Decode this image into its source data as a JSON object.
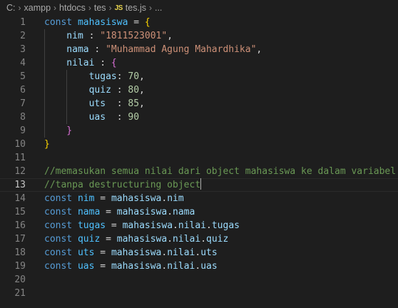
{
  "breadcrumb": {
    "items": [
      "C:",
      "xampp",
      "htdocs",
      "tes"
    ],
    "file_icon": "JS",
    "file_name": "tes.js",
    "ellipsis": "..."
  },
  "editor": {
    "current_line": 13,
    "lines": [
      {
        "n": 1,
        "indent": 0,
        "tokens": [
          [
            "const ",
            "t-keyword"
          ],
          [
            "mahasiswa",
            "t-const"
          ],
          [
            " = ",
            "t-punct"
          ],
          [
            "{",
            "t-brace1"
          ]
        ]
      },
      {
        "n": 2,
        "indent": 1,
        "tokens": [
          [
            "nim",
            "t-var"
          ],
          [
            " : ",
            "t-punct"
          ],
          [
            "\"1811523001\"",
            "t-string"
          ],
          [
            ",",
            "t-punct"
          ]
        ]
      },
      {
        "n": 3,
        "indent": 1,
        "tokens": [
          [
            "nama",
            "t-var"
          ],
          [
            " : ",
            "t-punct"
          ],
          [
            "\"Muhammad Agung Mahardhika\"",
            "t-string"
          ],
          [
            ",",
            "t-punct"
          ]
        ]
      },
      {
        "n": 4,
        "indent": 1,
        "tokens": [
          [
            "nilai",
            "t-var"
          ],
          [
            " : ",
            "t-punct"
          ],
          [
            "{",
            "t-brace2"
          ]
        ]
      },
      {
        "n": 5,
        "indent": 2,
        "tokens": [
          [
            "tugas",
            "t-var"
          ],
          [
            ": ",
            "t-punct"
          ],
          [
            "70",
            "t-number"
          ],
          [
            ",",
            "t-punct"
          ]
        ]
      },
      {
        "n": 6,
        "indent": 2,
        "tokens": [
          [
            "quiz",
            "t-var"
          ],
          [
            " : ",
            "t-punct"
          ],
          [
            "80",
            "t-number"
          ],
          [
            ",",
            "t-punct"
          ]
        ]
      },
      {
        "n": 7,
        "indent": 2,
        "tokens": [
          [
            "uts",
            "t-var"
          ],
          [
            "  : ",
            "t-punct"
          ],
          [
            "85",
            "t-number"
          ],
          [
            ",",
            "t-punct"
          ]
        ]
      },
      {
        "n": 8,
        "indent": 2,
        "tokens": [
          [
            "uas",
            "t-var"
          ],
          [
            "  : ",
            "t-punct"
          ],
          [
            "90",
            "t-number"
          ]
        ]
      },
      {
        "n": 9,
        "indent": 1,
        "tokens": [
          [
            "}",
            "t-brace2"
          ]
        ]
      },
      {
        "n": 10,
        "indent": 0,
        "tokens": [
          [
            "}",
            "t-brace1"
          ]
        ]
      },
      {
        "n": 11,
        "indent": 0,
        "tokens": []
      },
      {
        "n": 12,
        "indent": 0,
        "tokens": [
          [
            "//memasukan semua nilai dari object mahasiswa ke dalam variabel",
            "t-comment"
          ]
        ]
      },
      {
        "n": 13,
        "indent": 0,
        "cursor": true,
        "tokens": [
          [
            "//tanpa destructuring object",
            "t-comment"
          ]
        ]
      },
      {
        "n": 14,
        "indent": 0,
        "tokens": [
          [
            "const ",
            "t-keyword"
          ],
          [
            "nim",
            "t-const"
          ],
          [
            " = ",
            "t-punct"
          ],
          [
            "mahasiswa",
            "t-var"
          ],
          [
            ".",
            "t-punct"
          ],
          [
            "nim",
            "t-var"
          ]
        ]
      },
      {
        "n": 15,
        "indent": 0,
        "tokens": [
          [
            "const ",
            "t-keyword"
          ],
          [
            "nama",
            "t-const"
          ],
          [
            " = ",
            "t-punct"
          ],
          [
            "mahasiswa",
            "t-var"
          ],
          [
            ".",
            "t-punct"
          ],
          [
            "nama",
            "t-var"
          ]
        ]
      },
      {
        "n": 16,
        "indent": 0,
        "tokens": [
          [
            "const ",
            "t-keyword"
          ],
          [
            "tugas",
            "t-const"
          ],
          [
            " = ",
            "t-punct"
          ],
          [
            "mahasiswa",
            "t-var"
          ],
          [
            ".",
            "t-punct"
          ],
          [
            "nilai",
            "t-var"
          ],
          [
            ".",
            "t-punct"
          ],
          [
            "tugas",
            "t-var"
          ]
        ]
      },
      {
        "n": 17,
        "indent": 0,
        "tokens": [
          [
            "const ",
            "t-keyword"
          ],
          [
            "quiz",
            "t-const"
          ],
          [
            " = ",
            "t-punct"
          ],
          [
            "mahasiswa",
            "t-var"
          ],
          [
            ".",
            "t-punct"
          ],
          [
            "nilai",
            "t-var"
          ],
          [
            ".",
            "t-punct"
          ],
          [
            "quiz",
            "t-var"
          ]
        ]
      },
      {
        "n": 18,
        "indent": 0,
        "tokens": [
          [
            "const ",
            "t-keyword"
          ],
          [
            "uts",
            "t-const"
          ],
          [
            " = ",
            "t-punct"
          ],
          [
            "mahasiswa",
            "t-var"
          ],
          [
            ".",
            "t-punct"
          ],
          [
            "nilai",
            "t-var"
          ],
          [
            ".",
            "t-punct"
          ],
          [
            "uts",
            "t-var"
          ]
        ]
      },
      {
        "n": 19,
        "indent": 0,
        "tokens": [
          [
            "const ",
            "t-keyword"
          ],
          [
            "uas",
            "t-const"
          ],
          [
            " = ",
            "t-punct"
          ],
          [
            "mahasiswa",
            "t-var"
          ],
          [
            ".",
            "t-punct"
          ],
          [
            "nilai",
            "t-var"
          ],
          [
            ".",
            "t-punct"
          ],
          [
            "uas",
            "t-var"
          ]
        ]
      },
      {
        "n": 20,
        "indent": 0,
        "tokens": []
      },
      {
        "n": 21,
        "indent": 0,
        "tokens": []
      }
    ]
  }
}
